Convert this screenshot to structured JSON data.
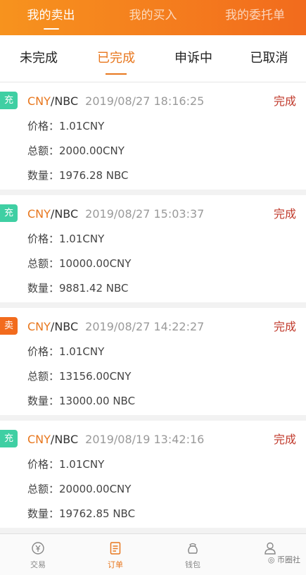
{
  "top_tabs": [
    "我的卖出",
    "我的买入",
    "我的委托单"
  ],
  "sub_tabs": [
    "未完成",
    "已完成",
    "申诉中",
    "已取消"
  ],
  "orders": [
    {
      "badge": "充",
      "badge_type": "chong",
      "cny": "CNY",
      "pair_rest": "/NBC",
      "time": "2019/08/27 18:16:25",
      "status": "完成",
      "price": "价格：1.01CNY",
      "total": "总额：2000.00CNY",
      "qty": "数量：1976.28 NBC"
    },
    {
      "badge": "充",
      "badge_type": "chong",
      "cny": "CNY",
      "pair_rest": "/NBC",
      "time": "2019/08/27 15:03:37",
      "status": "完成",
      "price": "价格：1.01CNY",
      "total": "总额：10000.00CNY",
      "qty": "数量：9881.42 NBC"
    },
    {
      "badge": "卖",
      "badge_type": "mai",
      "cny": "CNY",
      "pair_rest": "/NBC",
      "time": "2019/08/27 14:22:27",
      "status": "完成",
      "price": "价格：1.01CNY",
      "total": "总额：13156.00CNY",
      "qty": "数量：13000.00 NBC"
    },
    {
      "badge": "充",
      "badge_type": "chong",
      "cny": "CNY",
      "pair_rest": "/NBC",
      "time": "2019/08/19 13:42:16",
      "status": "完成",
      "price": "价格：1.01CNY",
      "total": "总额：20000.00CNY",
      "qty": "数量：19762.85 NBC"
    }
  ],
  "bottom_nav": [
    "交易",
    "订单",
    "钱包",
    ""
  ],
  "watermark": "币圈社",
  "colors": {
    "accent": "#e8771e",
    "top_gradient_start": "#f7931e",
    "top_gradient_end": "#f26b1d",
    "status_red": "#c0392b",
    "badge_green": "#3fcfa3",
    "badge_orange": "#f26b1d"
  }
}
